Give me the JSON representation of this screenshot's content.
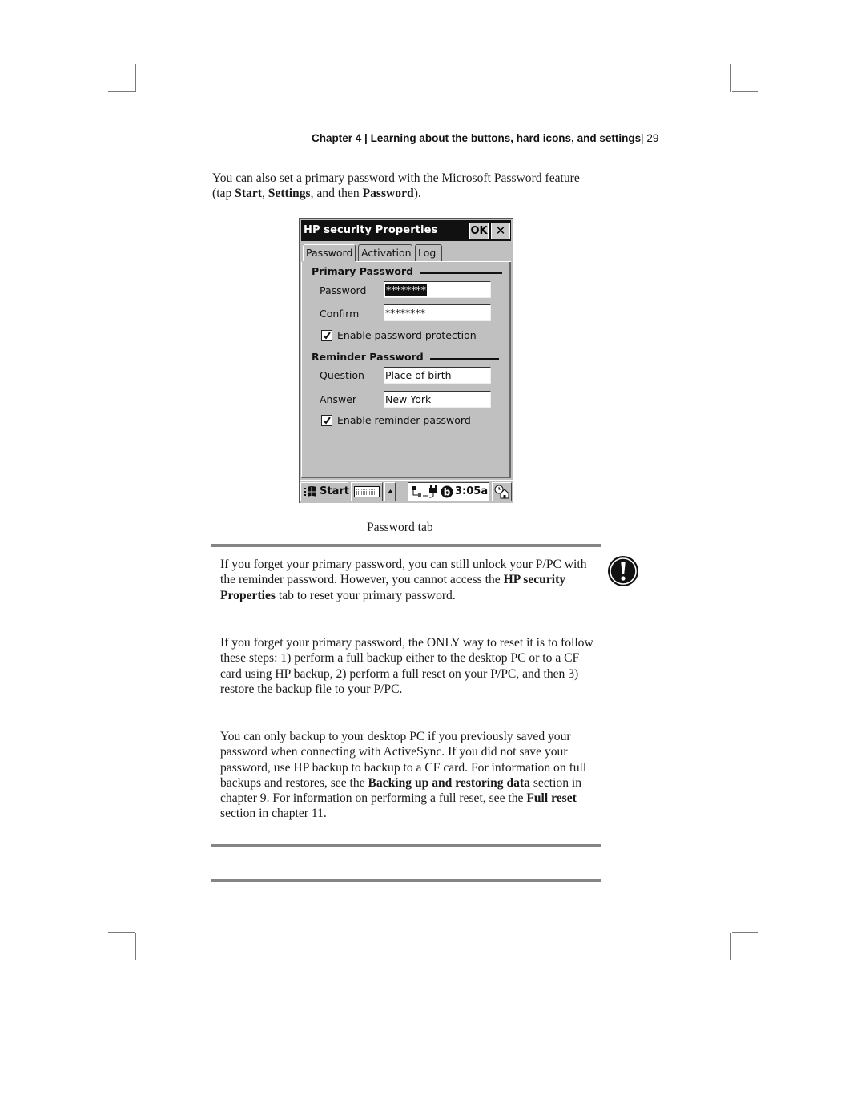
{
  "running_head": {
    "chapter": "Chapter 4",
    "separator": " | ",
    "title": "Learning about the buttons, hard icons, and settings",
    "page_separator": "| ",
    "page_number": "29"
  },
  "intro": {
    "text_1": "You can also set a primary password with the Microsoft Password feature (tap ",
    "bold_1": "Start",
    "text_2": ", ",
    "bold_2": "Settings",
    "text_3": ", and then ",
    "bold_3": "Password",
    "text_4": ")."
  },
  "screenshot": {
    "window_title": "HP security Properties",
    "ok_label": "OK",
    "close_label": "✕",
    "tabs": [
      {
        "label": "Password",
        "active": true
      },
      {
        "label": "Activation",
        "active": false
      },
      {
        "label": "Log",
        "active": false
      }
    ],
    "primary_section": {
      "heading": "Primary Password",
      "password_label": "Password",
      "password_value": "********",
      "confirm_label": "Confirm",
      "confirm_value": "********",
      "enable_checkbox_label": "Enable password protection",
      "enable_checked": true
    },
    "reminder_section": {
      "heading": "Reminder Password",
      "question_label": "Question",
      "question_value": "Place of birth",
      "answer_label": "Answer",
      "answer_value": "New York",
      "enable_checkbox_label": "Enable reminder password",
      "enable_checked": true
    },
    "taskbar": {
      "start_label": "Start",
      "time": "3:05a",
      "icons": [
        "start-flag-icon",
        "keyboard-icon",
        "input-arrow-up-icon",
        "connection-icon",
        "power-plug-icon",
        "bluetooth-b-icon",
        "today-home-icon"
      ]
    }
  },
  "caption": "Password tab",
  "note": {
    "icon": "exclamation-warning-icon",
    "p1": {
      "text_1": "If you forget your primary password, you can still unlock your P/PC with the reminder password. However, you cannot access the ",
      "bold_1": "HP security Properties",
      "text_2": " tab to reset your primary password."
    },
    "p2": {
      "text_1": "If you forget your primary password, the ONLY way to reset it is to follow these steps: 1) perform a full backup either to the desktop PC or to a CF card using HP backup, 2) perform a full reset on your P/PC, and then 3) restore the backup file to your P/PC."
    },
    "p3": {
      "text_1": "You can only backup to your desktop PC if you previously saved your password when connecting with ActiveSync. If you did not save your password, use HP backup to backup to a CF card. For information on full backups and restores, see the ",
      "bold_1": "Backing up and restoring data",
      "text_2": " section in chapter 9. For information on performing a full reset, see the ",
      "bold_2": "Full reset",
      "text_3": " section in chapter 11."
    }
  },
  "colors": {
    "rule": "#858585",
    "dialog_bg": "#c0c0c0",
    "titlebar_bg": "#111111"
  }
}
